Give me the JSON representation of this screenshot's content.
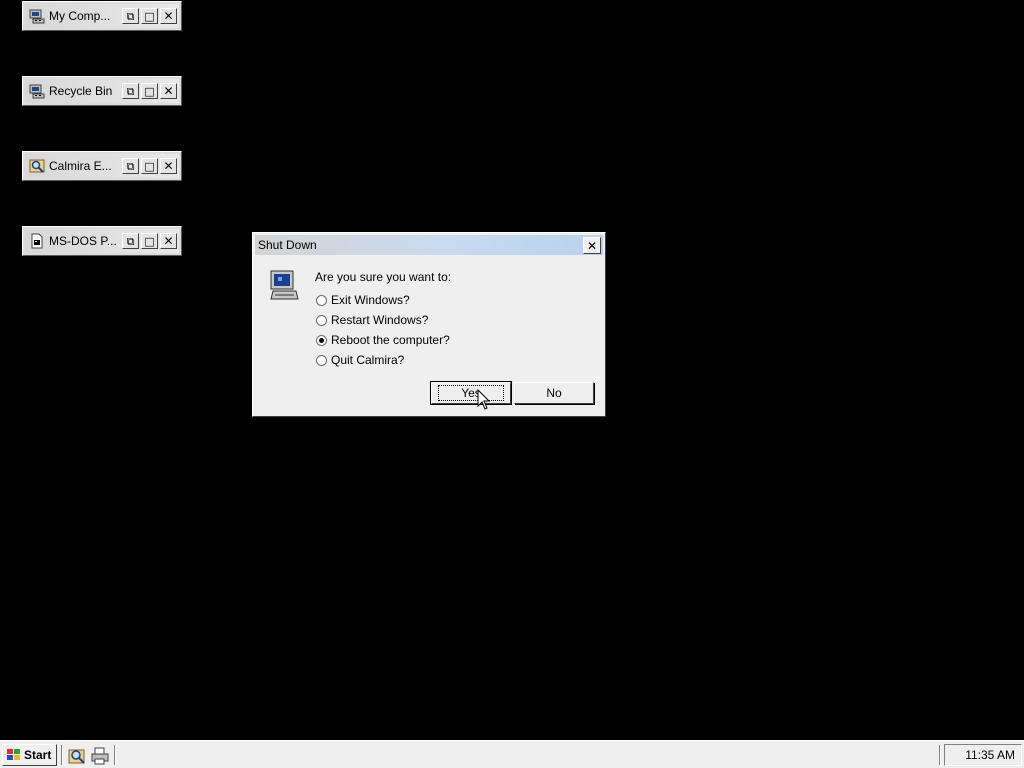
{
  "minimized_windows": [
    {
      "title": "My Comp...",
      "icon": "my-computer-icon"
    },
    {
      "title": "Recycle Bin",
      "icon": "recycle-bin-icon"
    },
    {
      "title": "Calmira E...",
      "icon": "explorer-icon"
    },
    {
      "title": "MS-DOS P...",
      "icon": "ms-dos-prompt-icon"
    }
  ],
  "dialog": {
    "title": "Shut Down",
    "prompt": "Are you sure you want to:",
    "options": [
      {
        "label": "Exit Windows?",
        "checked": false
      },
      {
        "label": "Restart Windows?",
        "checked": false
      },
      {
        "label": "Reboot the computer?",
        "checked": true
      },
      {
        "label": "Quit Calmira?",
        "checked": false
      }
    ],
    "yes_label": "Yes",
    "no_label": "No"
  },
  "taskbar": {
    "start_label": "Start",
    "quick_launch": [
      "explorer-icon",
      "printer-icon"
    ],
    "clock": "11:35 AM"
  },
  "colors": {
    "desktop": "#000000",
    "titlebar_gradient_end": "#b9d1ee",
    "face": "#efefef"
  }
}
